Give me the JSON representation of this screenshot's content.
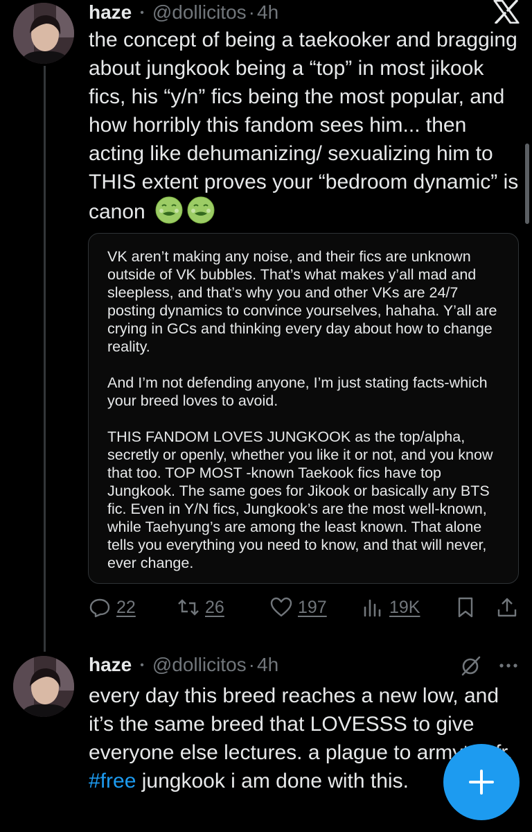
{
  "tweet1": {
    "author_name": "haze",
    "dot": "•",
    "handle": "@dollicitos",
    "separator": "·",
    "time": "4h",
    "text": "the concept of being a taekooker and bragging about jungkook being a “top” in most jikook fics, his “y/n” fics being the most popular, and how horribly this fandom sees him... then acting like dehumanizing/ sexualizing him to THIS extent proves your “bedroom dynamic” is canon",
    "emoji": [
      "nauseated-face",
      "nauseated-face"
    ],
    "quote_text": "VK aren’t making any noise, and their fics are unknown outside of VK bubbles. That’s what makes y’all mad and sleepless, and that’s why you and other VKs are 24/7 posting dynamics to convince yourselves, hahaha. Y’all are crying in GCs and thinking every day about how to change reality.\n\nAnd I’m not defending anyone, I’m just stating facts-which your breed loves to avoid.\n\nTHIS FANDOM LOVES JUNGKOOK as the top/alpha, secretly or openly, whether you like it or not, and you know that too. TOP MOST -known Taekook fics have top Jungkook. The same goes for Jikook or basically any BTS fic. Even in Y/N fics, Jungkook’s are the most well-known, while Taehyung’s are among the least known. That alone tells you everything you need to know, and that will never, ever change.",
    "actions": {
      "replies": "22",
      "reposts": "26",
      "likes": "197",
      "views": "19K"
    }
  },
  "tweet2": {
    "author_name": "haze",
    "dot": "•",
    "handle": "@dollicitos",
    "separator": "·",
    "time": "4h",
    "text_before": "every day this breed reaches a new low, and it’s the same breed that LOVESSS to give everyone else lectures. a plague to armytwt fr. ",
    "hashtag": "#free",
    "text_after": " jungkook i am done with this."
  },
  "icons": {
    "close": "x-logo-icon",
    "reply": "reply-icon",
    "repost": "repost-icon",
    "like": "heart-icon",
    "views": "views-icon",
    "bookmark": "bookmark-icon",
    "share": "share-icon",
    "grok": "grok-icon",
    "more": "more-icon",
    "compose": "plus-icon"
  },
  "colors": {
    "background": "#000000",
    "text": "#e7e9ea",
    "muted": "#71767b",
    "accent": "#1d9bf0"
  }
}
